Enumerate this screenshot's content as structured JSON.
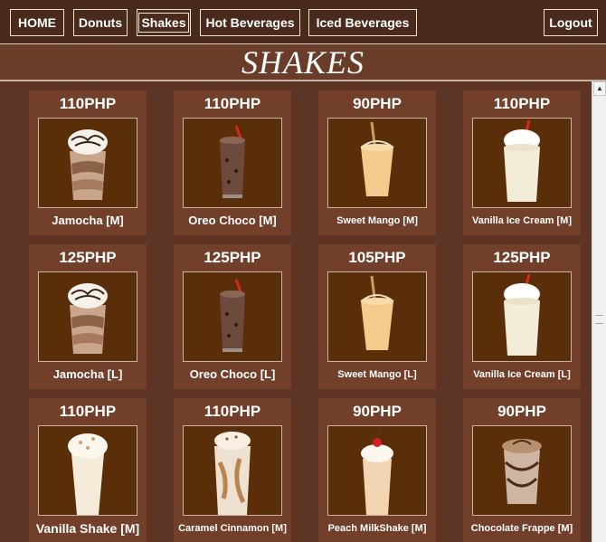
{
  "nav": {
    "home": "HOME",
    "donuts": "Donuts",
    "shakes": "Shakes",
    "hot": "Hot Beverages",
    "iced": "Iced Beverages",
    "logout": "Logout"
  },
  "page": {
    "title": "SHAKES"
  },
  "products": [
    {
      "price": "110PHP",
      "name": "Jamocha [M]",
      "icon": "jamocha-shake-icon"
    },
    {
      "price": "110PHP",
      "name": "Oreo Choco [M]",
      "icon": "oreo-choco-shake-icon"
    },
    {
      "price": "90PHP",
      "name": "Sweet  Mango [M]",
      "icon": "mango-shake-icon"
    },
    {
      "price": "110PHP",
      "name": "Vanilla Ice Cream [M]",
      "icon": "vanilla-ice-cream-shake-icon"
    },
    {
      "price": "125PHP",
      "name": "Jamocha [L]",
      "icon": "jamocha-shake-icon"
    },
    {
      "price": "125PHP",
      "name": "Oreo Choco [L]",
      "icon": "oreo-choco-shake-icon"
    },
    {
      "price": "105PHP",
      "name": "Sweet Mango [L]",
      "icon": "mango-shake-icon"
    },
    {
      "price": "125PHP",
      "name": "Vanilla Ice Cream [L]",
      "icon": "vanilla-ice-cream-shake-icon"
    },
    {
      "price": "110PHP",
      "name": "Vanilla Shake [M]",
      "icon": "vanilla-shake-icon"
    },
    {
      "price": "110PHP",
      "name": "Caramel Cinnamon [M]",
      "icon": "caramel-cinnamon-shake-icon"
    },
    {
      "price": "90PHP",
      "name": "Peach MilkShake [M]",
      "icon": "peach-milkshake-icon"
    },
    {
      "price": "90PHP",
      "name": "Chocolate Frappe [M]",
      "icon": "chocolate-frappe-icon"
    }
  ],
  "colors": {
    "background": "#5e3424",
    "card": "#723f2b",
    "image_bg": "#5a2e08",
    "nav_bg": "#4a2a1d"
  }
}
